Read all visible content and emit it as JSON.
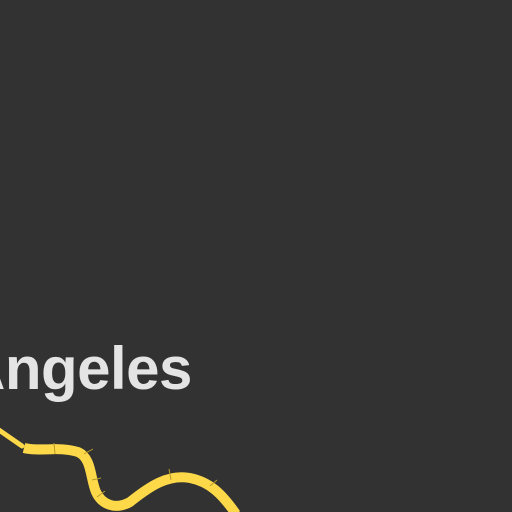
{
  "map": {
    "background_color": "#323232",
    "place_label": "Angeles",
    "label_color": "#e4e4e4",
    "highway_color": "#fdd94a",
    "highway_edge_color": "#b89a2a",
    "highway_segments": [
      {
        "name": "highway-main"
      },
      {
        "name": "highway-ramp"
      }
    ]
  }
}
